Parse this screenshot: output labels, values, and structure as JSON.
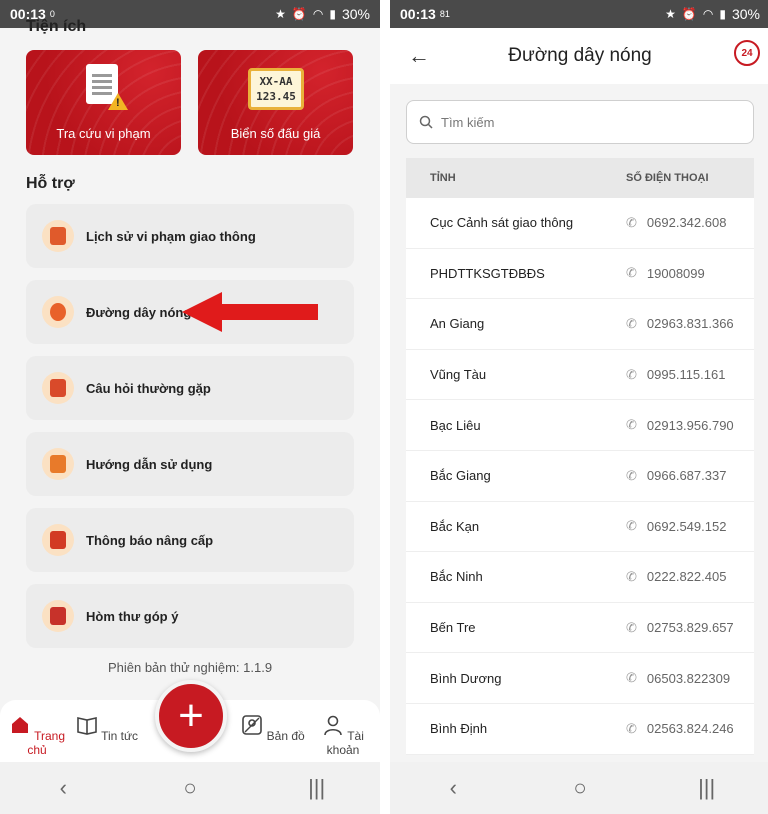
{
  "status_left": {
    "time": "00:13",
    "mini": "0",
    "battery": "30%"
  },
  "status_right": {
    "time": "00:13",
    "mini": "81",
    "battery": "30%"
  },
  "left": {
    "tien_ich_title": "Tiện ích",
    "tiles": [
      {
        "label": "Tra cứu vi phạm",
        "icon": "warning-document-icon"
      },
      {
        "label": "Biển số đấu giá",
        "icon": "license-plate-icon",
        "plate_line1": "XX-AA",
        "plate_line2": "123.45"
      }
    ],
    "ho_tro_title": "Hỗ trợ",
    "support_items": [
      {
        "label": "Lịch sử vi phạm giao thông",
        "icon": "history-icon"
      },
      {
        "label": "Đường dây nóng",
        "icon": "hotline-support-icon"
      },
      {
        "label": "Câu hỏi thường gặp",
        "icon": "faq-icon"
      },
      {
        "label": "Hướng dẫn sử dụng",
        "icon": "guide-icon"
      },
      {
        "label": "Thông báo nâng cấp",
        "icon": "notification-icon"
      },
      {
        "label": "Hòm thư góp ý",
        "icon": "mailbox-icon"
      }
    ],
    "version": "Phiên bản thử nghiệm: 1.1.9",
    "tabs": [
      {
        "label": "Trang chủ",
        "icon": "home-icon"
      },
      {
        "label": "Tin tức",
        "icon": "news-icon"
      },
      {
        "label": "Bản đồ",
        "icon": "map-icon"
      },
      {
        "label": "Tài khoản",
        "icon": "account-icon"
      }
    ],
    "fab_label": "+",
    "accent": "#c71a22"
  },
  "right": {
    "title": "Đường dây nóng",
    "hotline_badge": "24",
    "search_placeholder": "Tìm kiếm",
    "col_province": "TỈNH",
    "col_phone": "SỐ ĐIỆN THOẠI",
    "rows": [
      {
        "province": "Cục Cảnh sát giao thông",
        "phone": "0692.342.608"
      },
      {
        "province": "PHDTTKSGTĐBĐS",
        "phone": "19008099"
      },
      {
        "province": "An Giang",
        "phone": "02963.831.366"
      },
      {
        "province": "Vũng Tàu",
        "phone": "0995.115.161"
      },
      {
        "province": "Bạc Liêu",
        "phone": "02913.956.790"
      },
      {
        "province": "Bắc Giang",
        "phone": "0966.687.337"
      },
      {
        "province": "Bắc Kạn",
        "phone": "0692.549.152"
      },
      {
        "province": "Bắc Ninh",
        "phone": "0222.822.405"
      },
      {
        "province": "Bến Tre",
        "phone": "02753.829.657"
      },
      {
        "province": "Bình Dương",
        "phone": "06503.822309"
      },
      {
        "province": "Bình Định",
        "phone": "02563.824.246"
      }
    ]
  }
}
